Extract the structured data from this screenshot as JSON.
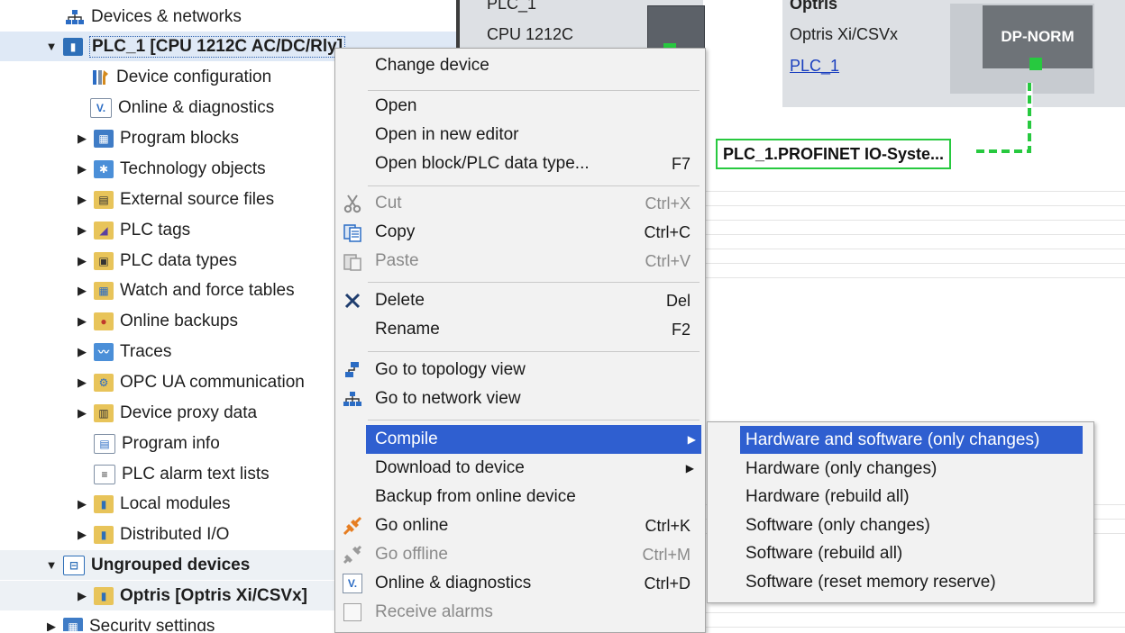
{
  "tree": {
    "items": [
      {
        "label": "Devices & networks"
      },
      {
        "label": "PLC_1 [CPU 1212C AC/DC/Rly]"
      },
      {
        "label": "Device configuration"
      },
      {
        "label": "Online & diagnostics"
      },
      {
        "label": "Program blocks"
      },
      {
        "label": "Technology objects"
      },
      {
        "label": "External source files"
      },
      {
        "label": "PLC tags"
      },
      {
        "label": "PLC data types"
      },
      {
        "label": "Watch and force tables"
      },
      {
        "label": "Online backups"
      },
      {
        "label": "Traces"
      },
      {
        "label": "OPC UA communication"
      },
      {
        "label": "Device proxy data"
      },
      {
        "label": "Program info"
      },
      {
        "label": "PLC alarm text lists"
      },
      {
        "label": "Local modules"
      },
      {
        "label": "Distributed I/O"
      },
      {
        "label": "Ungrouped devices"
      },
      {
        "label": "Optris [Optris Xi/CSVx]"
      },
      {
        "label": "Security settings"
      }
    ]
  },
  "network": {
    "plc": {
      "name": "PLC_1",
      "type": "CPU 1212C"
    },
    "optris": {
      "name": "Optris",
      "type": "Optris Xi/CSVx",
      "link": "PLC_1",
      "module": "DP-NORM"
    },
    "io_system": "PLC_1.PROFINET IO-Syste..."
  },
  "context_menu": {
    "items": [
      {
        "label": "Change device",
        "shortcut": ""
      },
      {
        "label": "Open",
        "shortcut": ""
      },
      {
        "label": "Open in new editor",
        "shortcut": ""
      },
      {
        "label": "Open block/PLC data type...",
        "shortcut": "F7"
      },
      {
        "label": "Cut",
        "shortcut": "Ctrl+X",
        "icon": "scissors-icon"
      },
      {
        "label": "Copy",
        "shortcut": "Ctrl+C",
        "icon": "copy-icon"
      },
      {
        "label": "Paste",
        "shortcut": "Ctrl+V",
        "icon": "paste-icon"
      },
      {
        "label": "Delete",
        "shortcut": "Del",
        "icon": "delete-x-icon"
      },
      {
        "label": "Rename",
        "shortcut": "F2"
      },
      {
        "label": "Go to topology view",
        "shortcut": "",
        "icon": "topology-icon"
      },
      {
        "label": "Go to network view",
        "shortcut": "",
        "icon": "network-icon"
      },
      {
        "label": "Compile",
        "shortcut": ""
      },
      {
        "label": "Download to device",
        "shortcut": ""
      },
      {
        "label": "Backup from online device",
        "shortcut": ""
      },
      {
        "label": "Go online",
        "shortcut": "Ctrl+K",
        "icon": "go-online-icon"
      },
      {
        "label": "Go offline",
        "shortcut": "Ctrl+M",
        "icon": "go-offline-icon"
      },
      {
        "label": "Online & diagnostics",
        "shortcut": "Ctrl+D",
        "icon": "diagnostics-icon"
      },
      {
        "label": "Receive alarms",
        "shortcut": "",
        "icon": "checkbox-icon"
      }
    ]
  },
  "compile_submenu": {
    "items": [
      {
        "label": "Hardware and software (only changes)"
      },
      {
        "label": "Hardware (only changes)"
      },
      {
        "label": "Hardware (rebuild all)"
      },
      {
        "label": "Software (only changes)"
      },
      {
        "label": "Software (rebuild all)"
      },
      {
        "label": "Software (reset memory reserve)"
      }
    ]
  },
  "colors": {
    "highlight": "#2f5fd0",
    "connection": "#27c93f",
    "device_bg": "#dde0e4"
  }
}
